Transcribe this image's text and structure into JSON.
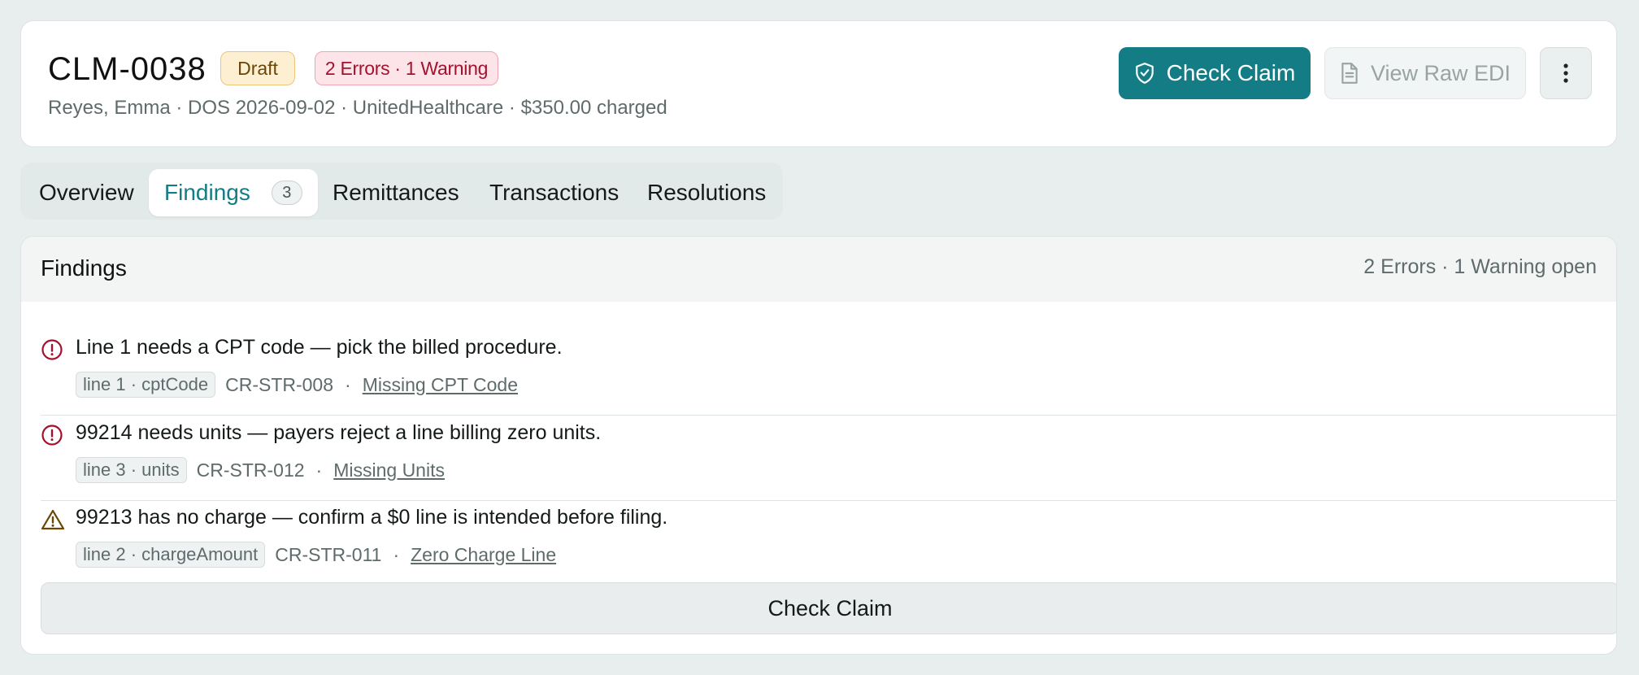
{
  "header": {
    "claim_id": "CLM-0038",
    "status_badge": "Draft",
    "issues_badge": "2 Errors · 1 Warning",
    "meta": "Reyes, Emma · DOS 2026-09-02 · UnitedHealthcare · $350.00 charged",
    "check_claim_label": "Check Claim",
    "view_raw_label": "View Raw EDI"
  },
  "tabs": [
    {
      "label": "Overview"
    },
    {
      "label": "Findings",
      "count": "3"
    },
    {
      "label": "Remittances"
    },
    {
      "label": "Transactions"
    },
    {
      "label": "Resolutions"
    }
  ],
  "findings": {
    "title": "Findings",
    "summary": "2 Errors · 1 Warning open",
    "items": [
      {
        "severity": "error",
        "icon": "error-circle-icon",
        "message": "Line 1 needs a CPT code — pick the billed procedure.",
        "field": "line 1 · cptCode",
        "code": "CR-STR-008",
        "rule": "Missing CPT Code"
      },
      {
        "severity": "error",
        "icon": "error-circle-icon",
        "message": "99214 needs units — payers reject a line billing zero units.",
        "field": "line 3 · units",
        "code": "CR-STR-012",
        "rule": "Missing Units"
      },
      {
        "severity": "warning",
        "icon": "warning-triangle-icon",
        "message": "99213 has no charge — confirm a $0 line is intended before filing.",
        "field": "line 2 · chargeAmount",
        "code": "CR-STR-011",
        "rule": "Zero Charge Line"
      }
    ],
    "bottom_button_label": "Check Claim"
  },
  "colors": {
    "accent": "#137c85",
    "error": "#a4122d",
    "warning": "#6b4606",
    "background": "#e8eeee"
  }
}
